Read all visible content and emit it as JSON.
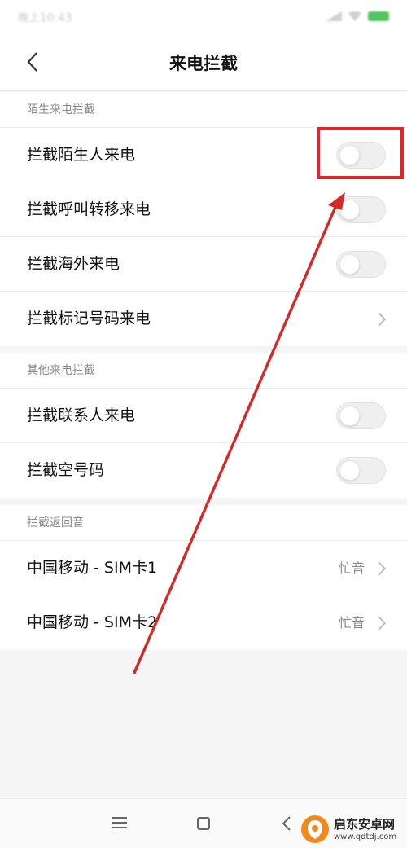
{
  "status_bar": {
    "time": "晚上10:43"
  },
  "header": {
    "title": "来电拦截"
  },
  "sections": [
    {
      "header": "陌生来电拦截",
      "rows": [
        {
          "label": "拦截陌生人来电",
          "control": "toggle",
          "on": false
        },
        {
          "label": "拦截呼叫转移来电",
          "control": "toggle",
          "on": false
        },
        {
          "label": "拦截海外来电",
          "control": "toggle",
          "on": false
        },
        {
          "label": "拦截标记号码来电",
          "control": "chevron"
        }
      ]
    },
    {
      "header": "其他来电拦截",
      "rows": [
        {
          "label": "拦截联系人来电",
          "control": "toggle",
          "on": false
        },
        {
          "label": "拦截空号码",
          "control": "toggle",
          "on": false
        }
      ]
    },
    {
      "header": "拦截返回音",
      "rows": [
        {
          "label": "中国移动 - SIM卡1",
          "control": "chevron",
          "value": "忙音"
        },
        {
          "label": "中国移动 - SIM卡2",
          "control": "chevron",
          "value": "忙音"
        }
      ]
    }
  ],
  "watermark": {
    "title": "启东安卓网",
    "url": "www.qdtdj.com"
  },
  "colors": {
    "annotation": "#e0262a",
    "battery": "#52c463"
  },
  "icons": [
    "back-arrow-icon",
    "chevron-right-icon",
    "menu-icon",
    "home-icon",
    "nav-back-icon"
  ]
}
